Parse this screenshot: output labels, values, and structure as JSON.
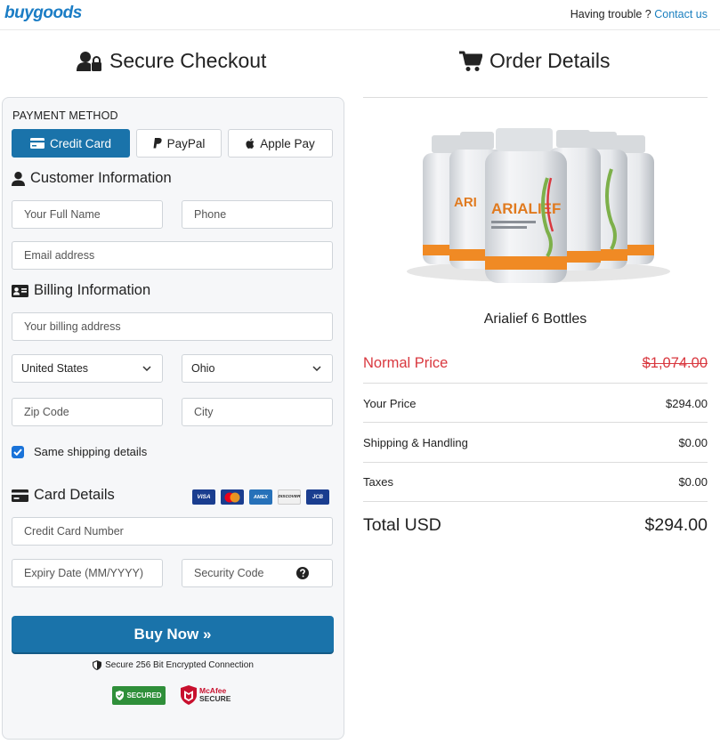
{
  "header": {
    "logo_part1": "buy",
    "logo_part2": "goods",
    "trouble_text": "Having trouble ?",
    "contact_link": "Contact us"
  },
  "checkout": {
    "title": "Secure Checkout",
    "payment_method_label": "PAYMENT METHOD",
    "payment_options": {
      "credit_card": "Credit Card",
      "paypal": "PayPal",
      "apple_pay": "Apple Pay"
    },
    "customer_info_title": "Customer Information",
    "full_name_placeholder": "Your Full Name",
    "phone_placeholder": "Phone",
    "email_placeholder": "Email address",
    "billing_info_title": "Billing Information",
    "billing_address_placeholder": "Your billing address",
    "country_selected": "United States",
    "state_selected": "Ohio",
    "zip_placeholder": "Zip Code",
    "city_placeholder": "City",
    "same_shipping_label": "Same shipping details",
    "same_shipping_checked": true,
    "card_details_title": "Card Details",
    "card_brands": [
      "VISA",
      "MC",
      "AMEX",
      "DISCOVER",
      "JCB"
    ],
    "card_number_placeholder": "Credit Card Number",
    "expiry_placeholder": "Expiry Date (MM/YYYY)",
    "security_code_placeholder": "Security Code",
    "buy_button": "Buy Now »",
    "secure_connection": "Secure 256 Bit Encrypted Connection",
    "badge_secured": "SECURED",
    "badge_mcafee_1": "McAfee",
    "badge_mcafee_2": "SECURE"
  },
  "order": {
    "title": "Order Details",
    "product_name": "Arialief 6 Bottles",
    "product_label": "ARIALIEF",
    "normal_price_label": "Normal Price",
    "normal_price_value": "$1,074.00",
    "your_price_label": "Your Price",
    "your_price_value": "$294.00",
    "shipping_label": "Shipping & Handling",
    "shipping_value": "$0.00",
    "taxes_label": "Taxes",
    "taxes_value": "$0.00",
    "total_label": "Total USD",
    "total_value": "$294.00"
  },
  "colors": {
    "primary": "#1a73aa",
    "link": "#1a7fbf",
    "normal_price": "#d9383f"
  }
}
